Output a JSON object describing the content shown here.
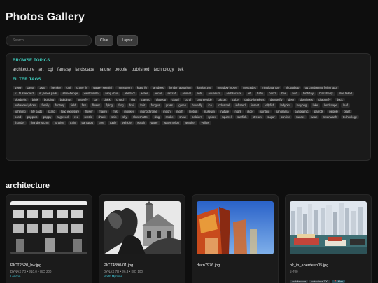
{
  "header": {
    "title": "Photos Gallery"
  },
  "search": {
    "placeholder": "Search...",
    "clear_label": "Clear",
    "layout_label": "Layout"
  },
  "filters": {
    "topics_heading": "BROWSE TOPICS",
    "topics": [
      "architecture",
      "art",
      "cgi",
      "fantasy",
      "landscape",
      "nature",
      "people",
      "published",
      "technology",
      "tek"
    ],
    "tags_heading": "FILTER TAGS",
    "tags": [
      "1999",
      "1980",
      "2MB",
      "bentley",
      "cgi",
      "crane fly",
      "galaxy s9 mini",
      "hometown",
      "kung fu",
      "lamdoss",
      "london aquarium",
      "london zoo",
      "meadow brown",
      "mercedes",
      "minolta a 700",
      "photoshop",
      "u1 continental flying spur",
      "u1 f1 standard",
      "st james park",
      "stonehenge",
      "westminster",
      "wing chun",
      "abstract",
      "action",
      "aerial",
      "aircraft",
      "animal",
      "ants",
      "aquarium",
      "architecture",
      "art",
      "baby",
      "band",
      "bee",
      "bird",
      "birthday",
      "blackberry",
      "blue tailed",
      "bluebells",
      "blink",
      "building",
      "buildings",
      "butterfly",
      "car",
      "chick",
      "church",
      "city",
      "classic",
      "closeup",
      "cloud",
      "coral",
      "countryside",
      "cricket",
      "cube",
      "daddy longlegs",
      "damselfly",
      "deer",
      "dominoes",
      "dragonfly",
      "duck",
      "enhanced photo",
      "family",
      "fantasy",
      "field",
      "fish",
      "flower",
      "flying",
      "frog",
      "fruit",
      "fruit",
      "fungus",
      "grass",
      "green",
      "hoverfly",
      "ice",
      "industrial",
      "infrared",
      "insect",
      "jellyfish",
      "ladybird",
      "ladybug",
      "lake",
      "landscape",
      "leaf",
      "lightning",
      "lily pads",
      "lizard",
      "long exposure",
      "flower",
      "macro",
      "mist",
      "monkey",
      "monochrome",
      "moon",
      "moth",
      "motion",
      "museum",
      "nature",
      "night",
      "older",
      "painting",
      "panorama",
      "panoramic",
      "parrots",
      "people",
      "plant",
      "pond",
      "poppies",
      "poppy",
      "ragweed",
      "red",
      "reptile",
      "shark",
      "ship",
      "sky",
      "slow shutter",
      "slug",
      "snake",
      "snow",
      "soldiers",
      "spider",
      "squirrel",
      "starfish",
      "stream",
      "sugar",
      "sunrise",
      "sunset",
      "swan",
      "swanwash",
      "technology",
      "thunder",
      "thunder storm",
      "tortoise",
      "train",
      "transport",
      "tree",
      "turtle",
      "vehicle",
      "watch",
      "water",
      "watermelon",
      "weather",
      "yellow"
    ]
  },
  "section": {
    "title": "architecture"
  },
  "cards": [
    {
      "filename": "PICT2520_bw.jpg",
      "meta": "DYNAX 7D • f/10.0 • ISO 200",
      "location": "London",
      "chips": []
    },
    {
      "filename": "PICT4390-01.jpg",
      "meta": "DYNAX 7D • f/6.3 • ISO 100",
      "location": "North Mymms",
      "chips": []
    },
    {
      "filename": "dscn7976.jpg",
      "meta": "",
      "location": "",
      "chips": []
    },
    {
      "filename": "hk_in_aberdeen05.jpg",
      "meta": "α-700",
      "location": "",
      "chips": [
        {
          "label": "architecture"
        },
        {
          "label": "minolta a 700"
        },
        {
          "label": "📍 Map",
          "kind": "map"
        }
      ]
    }
  ]
}
